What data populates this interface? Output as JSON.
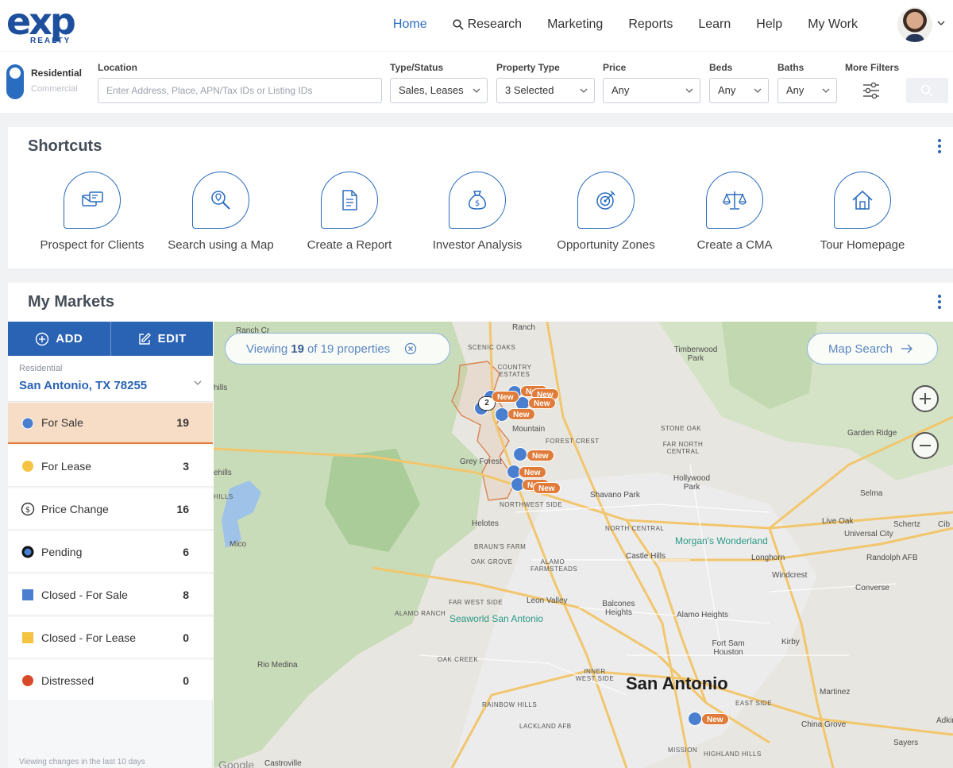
{
  "brand": {
    "logo_text": "exp",
    "logo_sub": "REALTY"
  },
  "nav": {
    "links": [
      "Home",
      "Research",
      "Marketing",
      "Reports",
      "Learn",
      "Help",
      "My Work"
    ],
    "active": "Home"
  },
  "search": {
    "segment_residential": "Residential",
    "segment_commercial": "Commercial",
    "location_label": "Location",
    "location_placeholder": "Enter Address, Place, APN/Tax IDs or Listing IDs",
    "type_label": "Type/Status",
    "type_value": "Sales, Leases",
    "ptype_label": "Property Type",
    "ptype_value": "3 Selected",
    "price_label": "Price",
    "price_value": "Any",
    "beds_label": "Beds",
    "beds_value": "Any",
    "baths_label": "Baths",
    "baths_value": "Any",
    "more_label": "More Filters"
  },
  "shortcuts": {
    "title": "Shortcuts",
    "items": [
      {
        "label": "Prospect for Clients",
        "icon": "envelope-cards-icon"
      },
      {
        "label": "Search using a Map",
        "icon": "map-search-icon"
      },
      {
        "label": "Create a Report",
        "icon": "document-icon"
      },
      {
        "label": "Investor Analysis",
        "icon": "money-bag-icon"
      },
      {
        "label": "Opportunity Zones",
        "icon": "target-icon"
      },
      {
        "label": "Create a CMA",
        "icon": "scales-icon"
      },
      {
        "label": "Tour Homepage",
        "icon": "home-icon"
      }
    ]
  },
  "markets": {
    "title": "My Markets",
    "add_label": "ADD",
    "edit_label": "EDIT",
    "select_label": "Residential",
    "select_value": "San Antonio, TX 78255",
    "statuses": [
      {
        "label": "For Sale",
        "count": "19",
        "icon": "blue-dot-icon",
        "color": "#4a7fd0"
      },
      {
        "label": "For Lease",
        "count": "3",
        "icon": "yellow-dot-icon",
        "color": "#f5c342"
      },
      {
        "label": "Price Change",
        "count": "16",
        "icon": "dollar-circle-icon",
        "color": "#333333"
      },
      {
        "label": "Pending",
        "count": "6",
        "icon": "pending-dot-icon",
        "color": "#1d4f9c"
      },
      {
        "label": "Closed - For Sale",
        "count": "8",
        "icon": "blue-square-icon",
        "color": "#4a7fd0"
      },
      {
        "label": "Closed - For Lease",
        "count": "0",
        "icon": "yellow-square-icon",
        "color": "#f5c342"
      },
      {
        "label": "Distressed",
        "count": "0",
        "icon": "red-dot-icon",
        "color": "#d94a2b"
      }
    ],
    "footer": "Viewing changes in the last 10 days"
  },
  "map": {
    "viewing_prefix": "Viewing",
    "viewing_count": "19",
    "viewing_suffix": "of 19 properties",
    "map_search": "Map Search",
    "new_tag": "New",
    "cluster_count": "2",
    "labels": {
      "ranch": "Ranch",
      "scenic_oaks": "SCENIC OAKS",
      "country_estates": "COUNTRY ESTATES",
      "timberwood": "Timberwood Park",
      "stone_oak": "STONE OAK",
      "far_north": "FAR NORTH CENTRAL",
      "garden_ridge": "Garden Ridge",
      "forest_crest": "FOREST CREST",
      "grey_forest": "Grey Forest",
      "mountain": "Mountain",
      "northwest_side": "NORTHWEST SIDE",
      "hollywood_park": "Hollywood Park",
      "shavano_park": "Shavano Park",
      "selma": "Selma",
      "helotes": "Helotes",
      "north_central": "NORTH CENTRAL",
      "live_oak": "Live Oak",
      "schertz": "Schertz",
      "universal_city": "Universal City",
      "mico": "Mico",
      "morgans": "Morgan's Wonderland",
      "brauns_farm": "BRAUN'S FARM",
      "oak_grove": "OAK GROVE",
      "alamo_farmsteads": "ALAMO FARMSTEADS",
      "castle_hills": "Castle Hills",
      "longhorn": "Longhorn",
      "randolph": "Randolph AFB",
      "windcrest": "Windcrest",
      "converse": "Converse",
      "far_west_side": "FAR WEST SIDE",
      "leon_valley": "Leon Valley",
      "balcones": "Balcones Heights",
      "alamo_heights": "Alamo Heights",
      "alamo_ranch": "ALAMO RANCH",
      "seaworld": "Seaworld San Antonio",
      "fort_sam": "Fort Sam Houston",
      "kirby": "Kirby",
      "rio_medina": "Rio Medina",
      "oak_creek": "OAK CREEK",
      "inner_west": "INNER WEST SIDE",
      "san_antonio": "San Antonio",
      "martinez": "Martinez",
      "rainbow_hills": "RAINBOW HILLS",
      "east_side": "EAST SIDE",
      "lackland": "LACKLAND AFB",
      "china_grove": "China Grove",
      "sayers": "Sayers",
      "mission": "MISSION",
      "highland_hills": "HIGHLAND HILLS",
      "castroville": "Castroville",
      "hills": "hills",
      "ehills": "ehills",
      "hills2": "HILLS",
      "ranch_cr": "Ranch Cr",
      "adkins": "Adkins",
      "cib": "Cib",
      "google": "Google"
    }
  }
}
